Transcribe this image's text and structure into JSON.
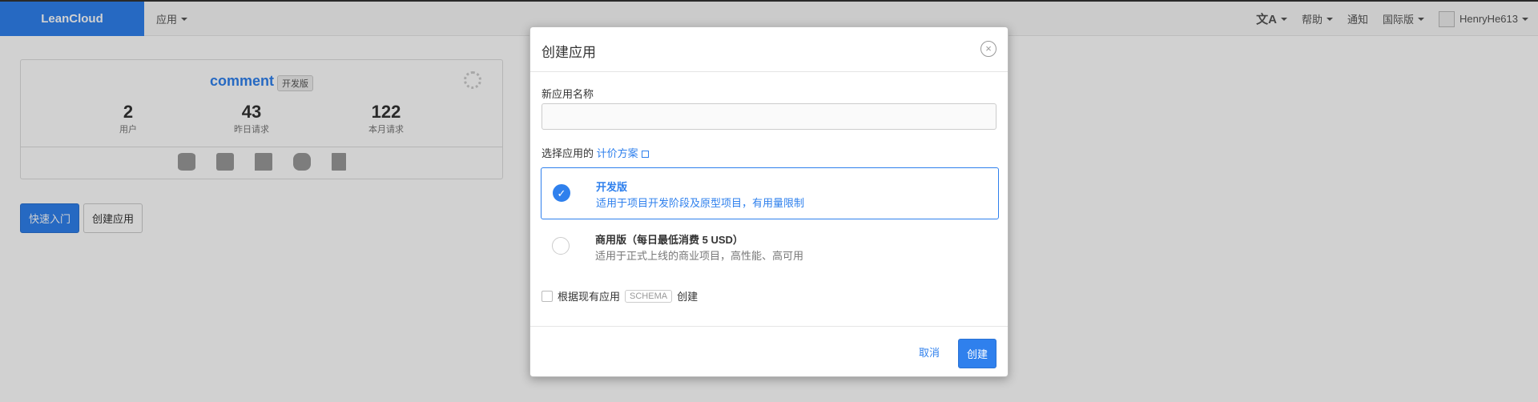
{
  "nav": {
    "brand": "LeanCloud",
    "apps": "应用",
    "help": "帮助",
    "notify": "通知",
    "region": "国际版",
    "user": "HenryHe613"
  },
  "card": {
    "app_name": "comment",
    "badge": "开发版",
    "stats": [
      {
        "value": "2",
        "label": "用户"
      },
      {
        "value": "43",
        "label": "昨日请求"
      },
      {
        "value": "122",
        "label": "本月请求"
      }
    ]
  },
  "buttons": {
    "quickstart": "快速入门",
    "create_app": "创建应用"
  },
  "modal": {
    "title": "创建应用",
    "name_label": "新应用名称",
    "name_value": "",
    "plan_prefix": "选择应用的",
    "plan_link": "计价方案",
    "plans": [
      {
        "name": "开发版",
        "desc": "适用于项目开发阶段及原型项目，有用量限制",
        "selected": true
      },
      {
        "name": "商用版（每日最低消费 5 USD）",
        "desc": "适用于正式上线的商业项目，高性能、高可用",
        "selected": false
      }
    ],
    "schema_before": "根据现有应用",
    "schema_code": "SCHEMA",
    "schema_after": "创建",
    "cancel": "取消",
    "create": "创建"
  },
  "colors": {
    "brand": "#2f80ed"
  }
}
